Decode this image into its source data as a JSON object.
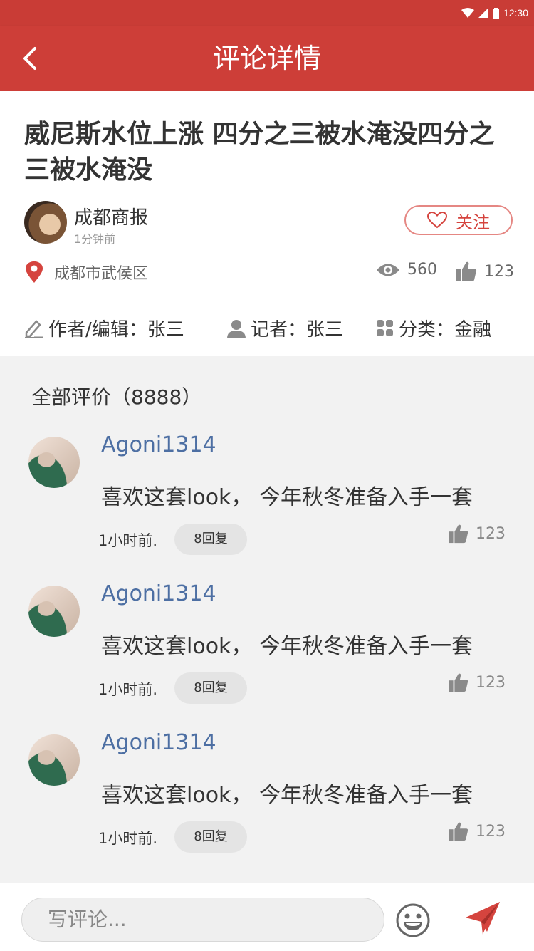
{
  "status_bar": {
    "time": "12:30"
  },
  "nav": {
    "title": "评论详情",
    "back_icon": "chevron-left-icon"
  },
  "article": {
    "headline": "威尼斯水位上涨 四分之三被水淹没四分之三被水淹没",
    "source": {
      "name": "成都商报",
      "time": "1分钟前"
    },
    "follow_label": "关注",
    "location": "成都市武侯区",
    "views": "560",
    "likes": "123",
    "meta": {
      "author_label": "作者/编辑：张三",
      "reporter_label": "记者：张三",
      "category_label": "分类：金融"
    }
  },
  "comments_section": {
    "title": "全部评价（8888）",
    "items": [
      {
        "user": "Agoni1314",
        "text": "喜欢这套look， 今年秋冬准备入手一套",
        "time": "1小时前.",
        "replies": "8回复",
        "likes": "123"
      },
      {
        "user": "Agoni1314",
        "text": "喜欢这套look， 今年秋冬准备入手一套",
        "time": "1小时前.",
        "replies": "8回复",
        "likes": "123"
      },
      {
        "user": "Agoni1314",
        "text": "喜欢这套look， 今年秋冬准备入手一套",
        "time": "1小时前.",
        "replies": "8回复",
        "likes": "123"
      }
    ]
  },
  "bottom_bar": {
    "placeholder": "写评论..."
  },
  "colors": {
    "brand_red": "#cd3e38",
    "link_blue": "#4d6fa3"
  }
}
